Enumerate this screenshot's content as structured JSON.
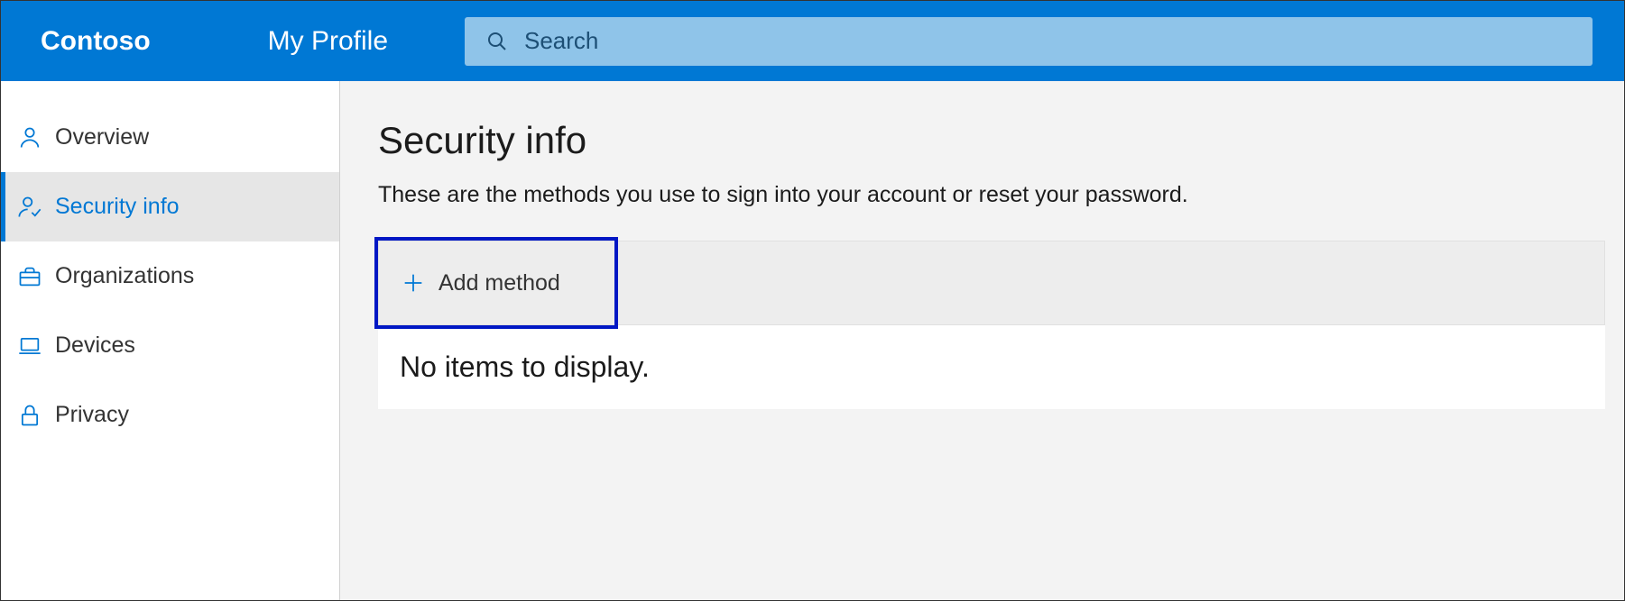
{
  "header": {
    "brand": "Contoso",
    "profile_title": "My Profile",
    "search_placeholder": "Search"
  },
  "sidebar": {
    "items": [
      {
        "id": "overview",
        "label": "Overview",
        "icon": "person-icon",
        "active": false
      },
      {
        "id": "security-info",
        "label": "Security info",
        "icon": "person-check-icon",
        "active": true
      },
      {
        "id": "organizations",
        "label": "Organizations",
        "icon": "briefcase-icon",
        "active": false
      },
      {
        "id": "devices",
        "label": "Devices",
        "icon": "laptop-icon",
        "active": false
      },
      {
        "id": "privacy",
        "label": "Privacy",
        "icon": "lock-icon",
        "active": false
      }
    ]
  },
  "main": {
    "title": "Security info",
    "subtitle": "These are the methods you use to sign into your account or reset your password.",
    "add_method_label": "Add method",
    "empty_message": "No items to display."
  }
}
